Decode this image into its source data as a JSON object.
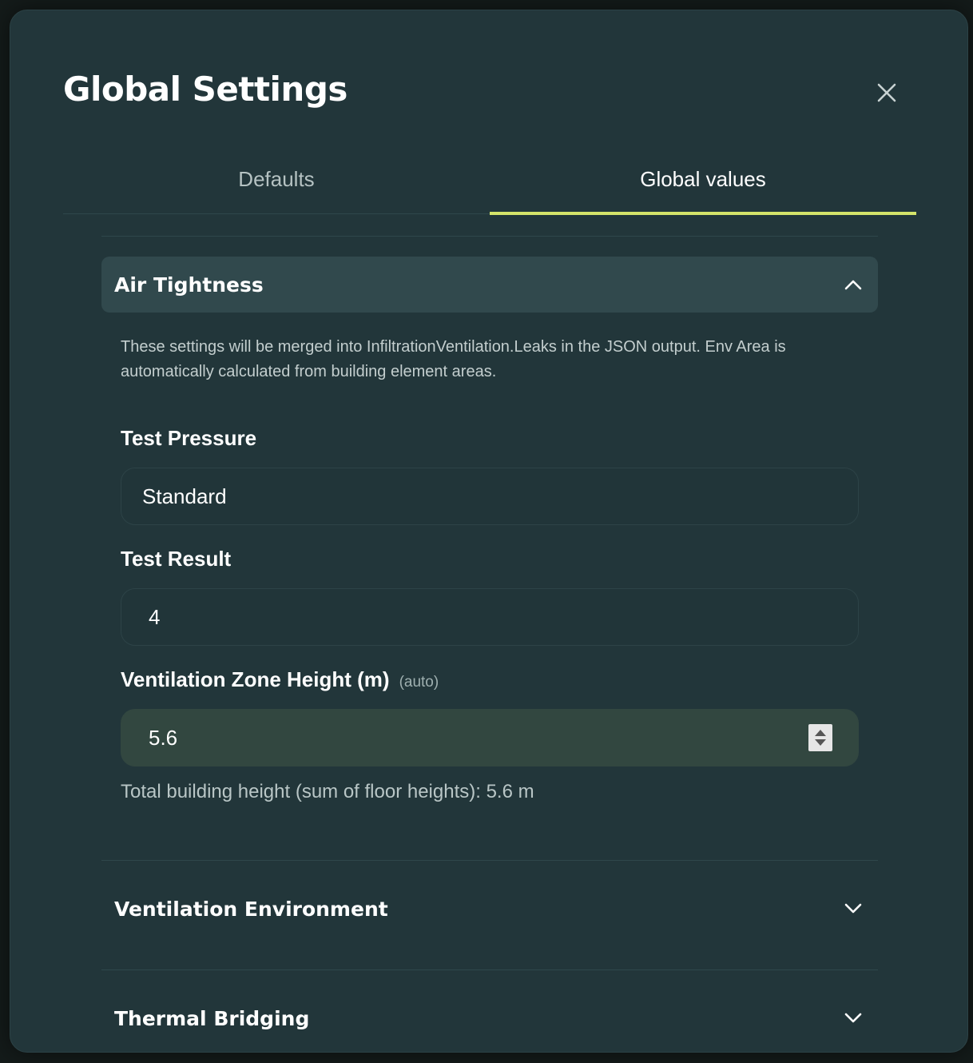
{
  "modal": {
    "title": "Global Settings",
    "close_icon": "close-icon"
  },
  "tabs": [
    {
      "label": "Defaults",
      "active": false
    },
    {
      "label": "Global values",
      "active": true
    }
  ],
  "sections": {
    "air_tightness": {
      "title": "Air Tightness",
      "expanded": true,
      "description": "These settings will be merged into InfiltrationVentilation.Leaks in the JSON output. Env Area is automatically calculated from building element areas.",
      "test_pressure": {
        "label": "Test Pressure",
        "value": "Standard"
      },
      "test_result": {
        "label": "Test Result",
        "value": "4"
      },
      "zone_height": {
        "label": "Ventilation Zone Height (m)",
        "note": "(auto)",
        "value": "5.6"
      },
      "hint": "Total building height (sum of floor heights): 5.6 m"
    },
    "ventilation_environment": {
      "title": "Ventilation Environment",
      "expanded": false
    },
    "thermal_bridging": {
      "title": "Thermal Bridging",
      "expanded": false
    }
  },
  "colors": {
    "accent": "#d4e46a",
    "panel": "#22363a",
    "header_open": "#31494d",
    "input_filled": "#324740"
  }
}
